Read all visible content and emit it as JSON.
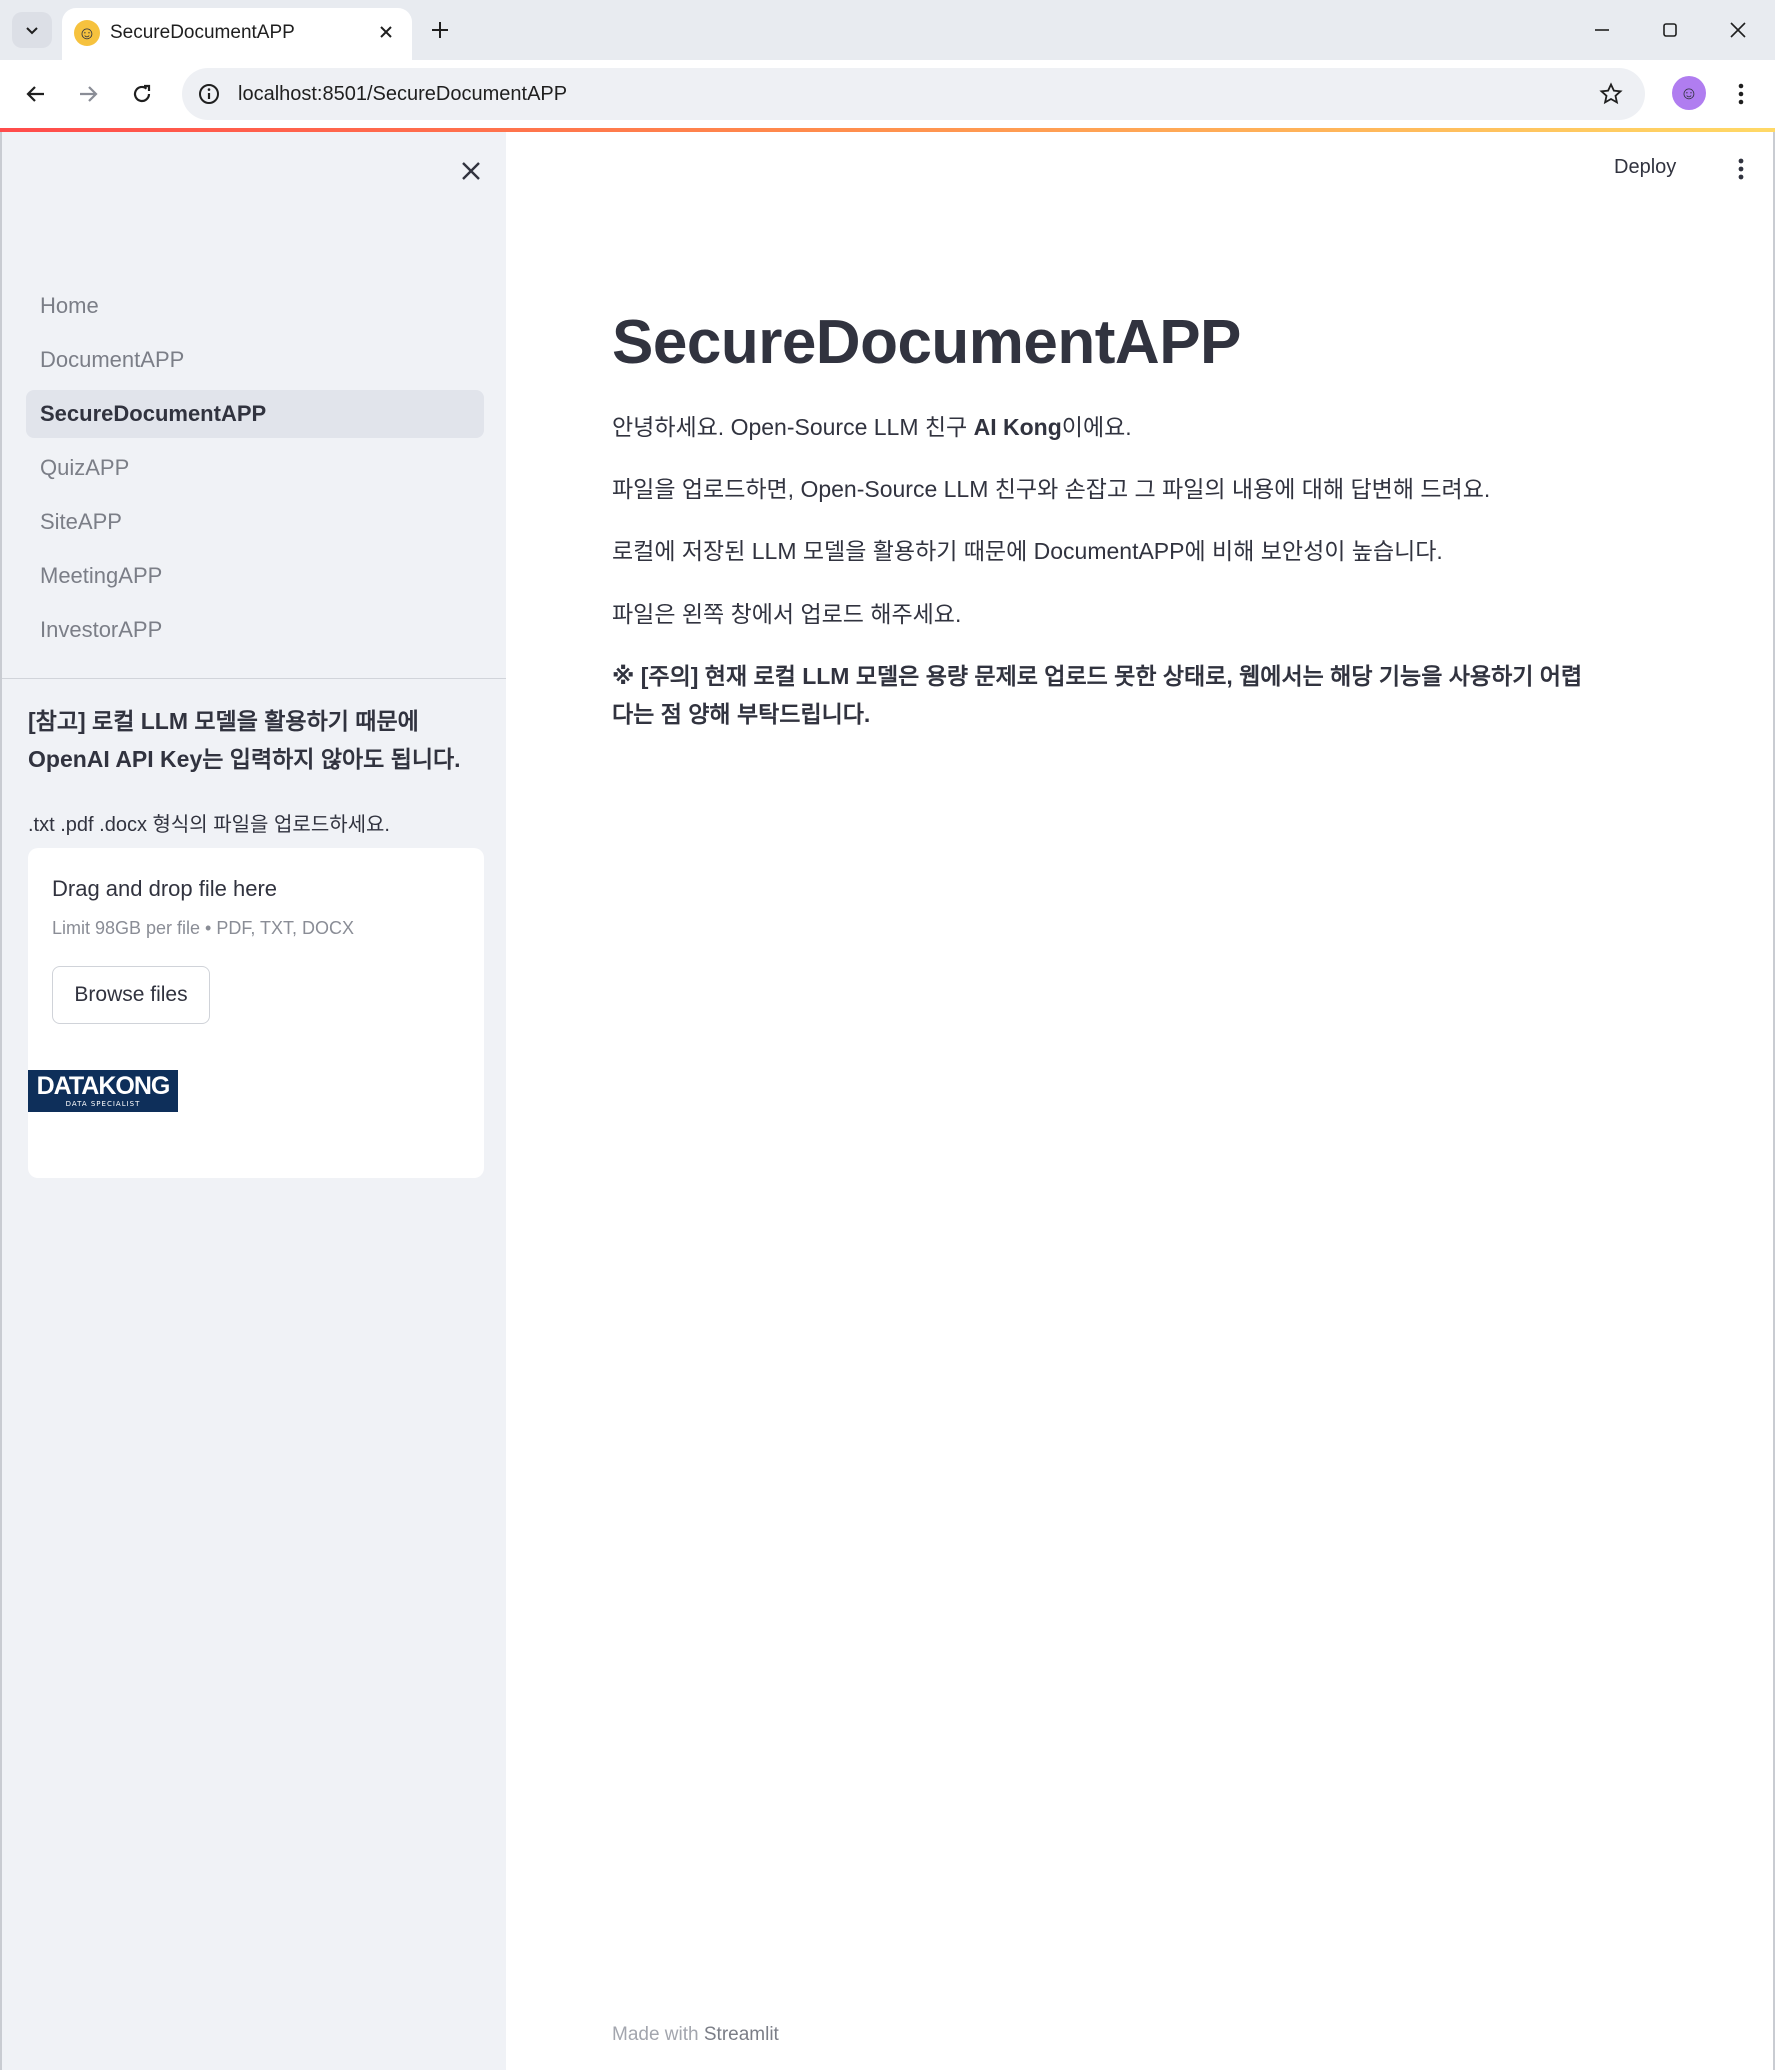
{
  "browser": {
    "tab_title": "SecureDocumentAPP",
    "url": "localhost:8501/SecureDocumentAPP"
  },
  "sidebar": {
    "nav": [
      {
        "label": "Home"
      },
      {
        "label": "DocumentAPP"
      },
      {
        "label": "SecureDocumentAPP",
        "active": true
      },
      {
        "label": "QuizAPP"
      },
      {
        "label": "SiteAPP"
      },
      {
        "label": "MeetingAPP"
      },
      {
        "label": "InvestorAPP"
      }
    ],
    "note_line1": "[참고] 로컬 LLM 모델을 활용하기 때문에",
    "note_line2": "OpenAI API Key는 입력하지 않아도 됩니다.",
    "formats_text": ".txt .pdf .docx 형식의 파일을 업로드하세요.",
    "uploader": {
      "title": "Drag and drop file here",
      "limit": "Limit 98GB per file • PDF, TXT, DOCX",
      "button": "Browse files"
    },
    "logo": {
      "main": "DATAKONG",
      "sub": "DATA SPECIALIST"
    }
  },
  "main": {
    "deploy_label": "Deploy",
    "title": "SecureDocumentAPP",
    "para1_pre": "안녕하세요. Open-Source LLM 친구 ",
    "para1_bold": "AI Kong",
    "para1_post": "이에요.",
    "para2": "파일을 업로드하면, Open-Source LLM 친구와 손잡고 그 파일의 내용에 대해 답변해 드려요.",
    "para3": "로컬에 저장된 LLM 모델을 활용하기 때문에 DocumentAPP에 비해 보안성이 높습니다.",
    "para4": "파일은 왼쪽 창에서 업로드 해주세요.",
    "warning_line1": "※ [주의] 현재 로컬 LLM 모델은 용량 문제로 업로드 못한 상태로, 웹에서는 해당 기능을 사용하기 어렵",
    "warning_line2": "다는 점 양해 부탁드립니다.",
    "footer_prefix": "Made with ",
    "footer_brand": "Streamlit"
  }
}
